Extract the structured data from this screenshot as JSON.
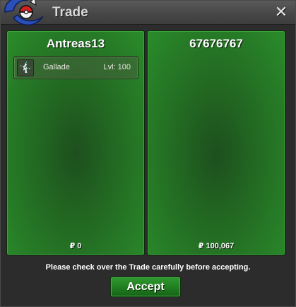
{
  "window": {
    "title": "Trade",
    "close_glyph": "✕",
    "logo_icon": "pokeball-logo-icon"
  },
  "trade": {
    "left": {
      "player_name": "Antreas13",
      "items": [
        {
          "icon": "gallade-sprite-icon",
          "name": "Gallade",
          "level": "Lvl: 100"
        }
      ],
      "money": "₽ 0"
    },
    "right": {
      "player_name": "67676767",
      "items": [],
      "money": "₽ 100,067"
    }
  },
  "footer": {
    "notice": "Please check over the Trade carefully before accepting.",
    "accept_label": "Accept"
  },
  "colors": {
    "panel_green": "#236b23",
    "accept_green": "#1f7a1f",
    "titlebar": "#474747"
  }
}
